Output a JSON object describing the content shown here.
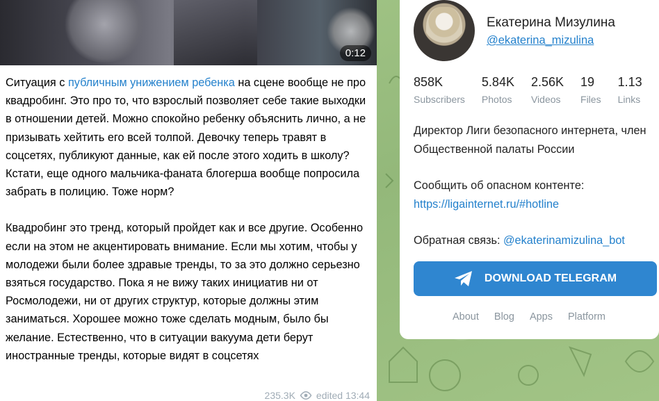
{
  "post": {
    "video_duration": "0:12",
    "paragraph1_before_link": "Ситуация с ",
    "paragraph1_link": "публичным унижением ребенка",
    "paragraph1_after_link": " на сцене вообще не про квадробинг. Это про то, что взрослый позволяет себе такие выходки в отношении детей. Можно спокойно ребенку объяснить лично, а не призывать хейтить его всей толпой. Девочку теперь травят в соцсетях, публикуют данные, как ей после этого ходить в школу? Кстати, еще одного мальчика-фаната блогерша вообще попросила забрать в полицию. Тоже норм?",
    "paragraph2": "Квадробинг это тренд, который пройдет как и все другие. Особенно если на этом не акцентировать внимание. Если мы хотим, чтобы у молодежи были более здравые тренды, то за это должно серьезно взяться государство. Пока я не вижу таких инициатив ни от Росмолодежи, ни от других структур, которые должны этим заниматься. Хорошее можно тоже сделать модным, было бы желание. Естественно, что в ситуации вакуума дети берут иностранные тренды, которые видят в соцсетях",
    "views": "235.3K",
    "edited": "edited 13:44"
  },
  "channel": {
    "name": "Екатерина Мизулина",
    "username": "@ekaterina_mizulina",
    "stats": [
      {
        "num": "858K",
        "label": "Subscribers"
      },
      {
        "num": "5.84K",
        "label": "Photos"
      },
      {
        "num": "2.56K",
        "label": "Videos"
      },
      {
        "num": "19",
        "label": "Files"
      },
      {
        "num": "1.13",
        "label": "Links"
      }
    ],
    "desc1": "Директор Лиги безопасного интернета, член Общественной палаты России",
    "desc2_text": "Сообщить об опасном контенте:",
    "desc2_link": "https://ligainternet.ru/#hotline",
    "desc3_text": "Обратная связь: ",
    "desc3_link": "@ekaterinamizulina_bot",
    "download_label": "DOWNLOAD TELEGRAM",
    "footer": [
      "About",
      "Blog",
      "Apps",
      "Platform"
    ]
  },
  "colors": {
    "accent": "#2481cc",
    "button": "#2f86d0",
    "background": "#9bbf83"
  },
  "icons": {
    "views": "eye-icon",
    "download": "telegram-plane-icon"
  }
}
